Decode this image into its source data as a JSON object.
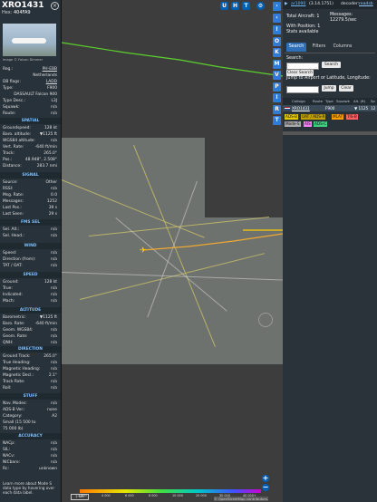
{
  "aircraft": {
    "callsign": "XRO1431",
    "hex_label": "Hex:",
    "hex": "404FA9",
    "photo_credit": "Image © Falcon Dimmer"
  },
  "details": [
    {
      "k": "Reg.:",
      "v": "PH-EBB"
    },
    {
      "k": "",
      "v": "Netherlands"
    },
    {
      "k": "DB flags:",
      "v": "LADD"
    },
    {
      "k": "Type:",
      "v": "F900"
    },
    {
      "k": "",
      "v": "DASSAULT Falcon 900"
    },
    {
      "k": "Type Desc.:",
      "v": "L3J"
    },
    {
      "k": "Squawk:",
      "v": "n/a"
    },
    {
      "k": "Route:",
      "v": "n/a"
    }
  ],
  "spatial_title": "SPATIAL",
  "spatial": [
    {
      "k": "Groundspeed:",
      "v": "128 kt"
    },
    {
      "k": "Baro. altitude:",
      "v": "▼1125 ft"
    },
    {
      "k": "WGS84 altitude:",
      "v": "n/a"
    },
    {
      "k": "Vert. Rate:",
      "v": "-640 ft/min"
    },
    {
      "k": "Track:",
      "v": "265.0°"
    },
    {
      "k": "Pos.:",
      "v": "48.948°, 2.508°"
    },
    {
      "k": "Distance:",
      "v": "283.7 nmi"
    }
  ],
  "signal_title": "SIGNAL",
  "signal": [
    {
      "k": "Source:",
      "v": "Other"
    },
    {
      "k": "RSSI:",
      "v": "n/a"
    },
    {
      "k": "Msg. Rate:",
      "v": "0.0"
    },
    {
      "k": "Messages:",
      "v": "1252"
    },
    {
      "k": "Last Pos.:",
      "v": "39 s"
    },
    {
      "k": "Last Seen:",
      "v": "29 s"
    }
  ],
  "fms_title": "FMS SEL",
  "fms": [
    {
      "k": "Sel. Alt.:",
      "v": "n/a"
    },
    {
      "k": "Sel. Head.:",
      "v": "n/a"
    }
  ],
  "wind_title": "WIND",
  "wind": [
    {
      "k": "Speed:",
      "v": "n/a"
    },
    {
      "k": "Direction (from):",
      "v": "n/a"
    },
    {
      "k": "TAT / OAT:",
      "v": "n/a"
    }
  ],
  "speed_title": "SPEED",
  "speed": [
    {
      "k": "Ground:",
      "v": "128 kt"
    },
    {
      "k": "True:",
      "v": "n/a"
    },
    {
      "k": "Indicated:",
      "v": "n/a"
    },
    {
      "k": "Mach:",
      "v": "n/a"
    }
  ],
  "altitude_title": "ALTITUDE",
  "altitude": [
    {
      "k": "Barometric:",
      "v": "▼1125 ft"
    },
    {
      "k": "Baro. Rate:",
      "v": "-640 ft/min"
    },
    {
      "k": "Geom. WGS84:",
      "v": "n/a"
    },
    {
      "k": "Geom. Rate:",
      "v": "n/a"
    },
    {
      "k": "QNH:",
      "v": "n/a"
    }
  ],
  "direction_title": "DIRECTION",
  "direction": [
    {
      "k": "Ground Track:",
      "v": "265.0°"
    },
    {
      "k": "True Heading:",
      "v": "n/a"
    },
    {
      "k": "Magnetic Heading:",
      "v": "n/a"
    },
    {
      "k": "Magnetic Decl.:",
      "v": "2.1°"
    },
    {
      "k": "Track Rate:",
      "v": "n/a"
    },
    {
      "k": "Roll:",
      "v": "n/a"
    }
  ],
  "stuff_title": "STUFF",
  "stuff": [
    {
      "k": "Nav. Modes:",
      "v": "n/a"
    },
    {
      "k": "ADS-B Ver.:",
      "v": "none"
    },
    {
      "k": "Category:",
      "v": "A2"
    },
    {
      "k": "Small (15 500 to",
      "v": ""
    },
    {
      "k": "75 000 lb)",
      "v": ""
    }
  ],
  "accuracy_title": "ACCURACY",
  "accuracy": [
    {
      "k": "NACp:",
      "v": "n/a"
    },
    {
      "k": "SIL:",
      "v": "n/a"
    },
    {
      "k": "NACv:",
      "v": "n/a"
    },
    {
      "k": "NICbaro:",
      "v": "n/a"
    },
    {
      "k": "Rc:",
      "v": "unknown"
    }
  ],
  "learn_more": "Learn more about Mode S data type by hovering over each data label.",
  "map": {
    "buttons_top": [
      "U",
      "H",
      "T"
    ],
    "side_buttons": [
      "I",
      "O",
      "K",
      "M",
      "V",
      "P",
      "I",
      "R",
      "T"
    ],
    "scale_label": "2 NM",
    "attribution": "© OpenStreetMap contributors.",
    "zoom_in": "+",
    "zoom_out": "−",
    "altitude_ticks": [
      "2 000",
      "4 000",
      "6 000",
      "8 000",
      "10 000",
      "20 000",
      "30 000",
      "40 000+"
    ]
  },
  "status": {
    "site": "ar1090",
    "version": "(3.14.1751)",
    "decoder": "decoder:",
    "decoder_state": "readsb",
    "total_aircraft_label": "Total Aircraft:",
    "total_aircraft": "1",
    "messages_label": "Messages:",
    "messages": "12279.5/sec",
    "with_position_label": "With Position:",
    "with_position": "1",
    "stats": "Stats available"
  },
  "tabs": [
    "Search",
    "Filters",
    "Columns"
  ],
  "search": {
    "label": "Search:",
    "button": "Search",
    "clear_route": "Clear Search",
    "jump_label": "Jump to Airport or Latitude, Longitude:",
    "jump_btn": "Jump",
    "clear_btn": "Clear"
  },
  "table": {
    "headers": [
      "Callsign",
      "Route",
      "Type",
      "Squawk",
      "Alt. (ft)",
      "Sp"
    ],
    "row": {
      "callsign": "XRO1431",
      "route": "",
      "type": "F900",
      "squawk": "",
      "alt": "▼ 1125",
      "spd": "12"
    }
  },
  "source_tags": [
    "ADS-B",
    "UAT / ADS-R",
    "MLAT",
    "TIS-B",
    "Mode-S",
    "AIS",
    "ADS-C"
  ]
}
